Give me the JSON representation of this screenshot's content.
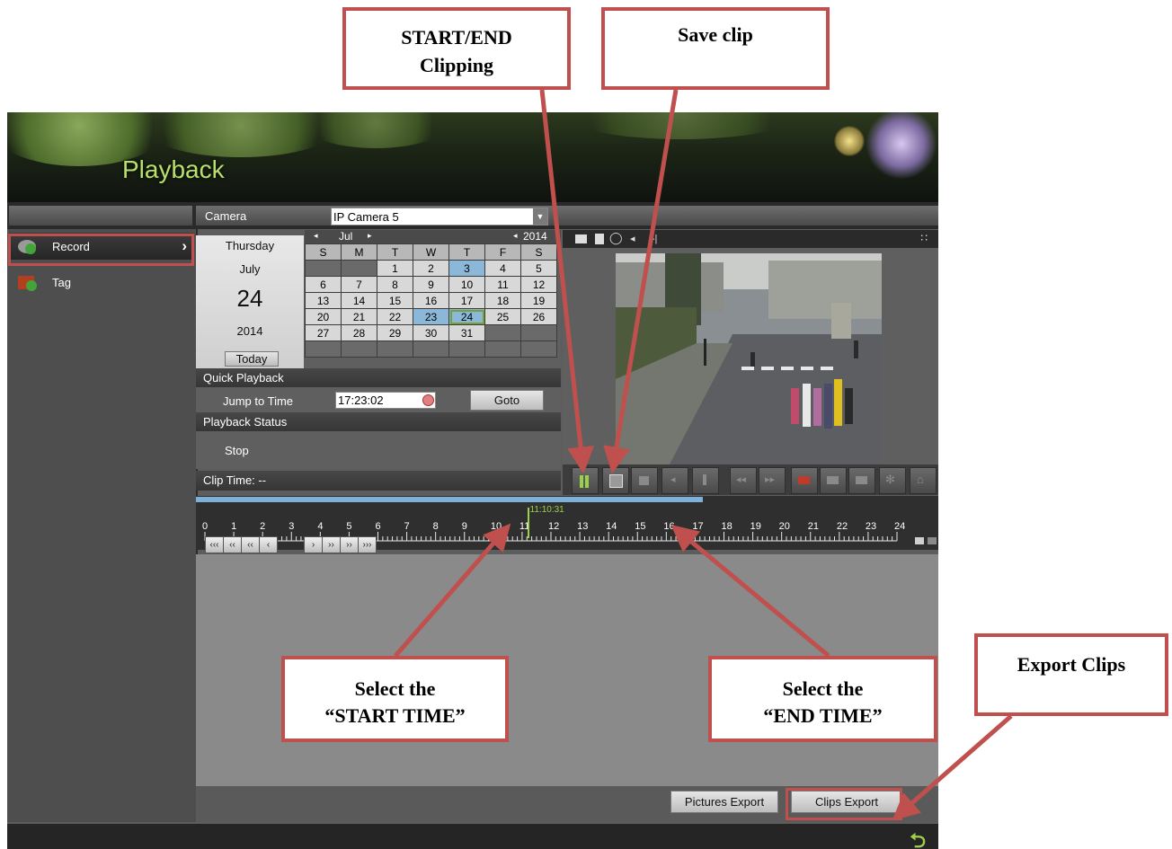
{
  "app": {
    "title": "Playback"
  },
  "sidebar": {
    "items": [
      {
        "label": "Record",
        "chevron": "›",
        "icon": "record-icon"
      },
      {
        "label": "Tag",
        "icon": "tag-icon"
      }
    ]
  },
  "camera": {
    "label": "Camera",
    "value": "IP Camera 5"
  },
  "date": {
    "weekday": "Thursday",
    "month": "July",
    "day": "24",
    "year": "2014",
    "today_button": "Today"
  },
  "calendar": {
    "month_label": "Jul",
    "year_label": "2014",
    "weekdays": [
      "S",
      "M",
      "T",
      "W",
      "T",
      "F",
      "S"
    ],
    "weeks": [
      [
        "",
        "",
        "1",
        "2",
        "3",
        "4",
        "5"
      ],
      [
        "6",
        "7",
        "8",
        "9",
        "10",
        "11",
        "12"
      ],
      [
        "13",
        "14",
        "15",
        "16",
        "17",
        "18",
        "19"
      ],
      [
        "20",
        "21",
        "22",
        "23",
        "24",
        "25",
        "26"
      ],
      [
        "27",
        "28",
        "29",
        "30",
        "31",
        "",
        ""
      ],
      [
        "",
        "",
        "",
        "",
        "",
        "",
        ""
      ]
    ],
    "recorded_days": [
      "3",
      "23"
    ],
    "selected_day": "24"
  },
  "quick_playback": {
    "header": "Quick Playback",
    "jump_label": "Jump to Time",
    "time_value": "17:23:02",
    "goto_button": "Goto"
  },
  "playback_status": {
    "header": "Playback Status",
    "status": "Stop"
  },
  "clip_time": {
    "label": "Clip Time: --"
  },
  "timeline": {
    "hours": [
      "0",
      "1",
      "2",
      "3",
      "4",
      "5",
      "6",
      "7",
      "8",
      "9",
      "10",
      "11",
      "12",
      "13",
      "14",
      "15",
      "16",
      "17",
      "18",
      "19",
      "20",
      "21",
      "22",
      "23",
      "24"
    ],
    "cursor_time": "11:10:31",
    "recorded_fraction": 0.72,
    "nav_buttons": [
      "‹‹‹",
      "‹‹",
      "‹‹",
      "‹",
      "›",
      "››",
      "››",
      "›››"
    ]
  },
  "export": {
    "pictures_button": "Pictures Export",
    "clips_button": "Clips Export"
  },
  "annotations": {
    "start_end": "START/END\nClipping",
    "save_clip": "Save clip",
    "start_time": "Select the\n“START TIME”",
    "end_time": "Select the\n“END TIME”",
    "export_clips": "Export Clips"
  },
  "colors": {
    "annotation_red": "#c0504d",
    "title_green": "#b8e06a",
    "recorded_blue": "#8bb8d8"
  }
}
